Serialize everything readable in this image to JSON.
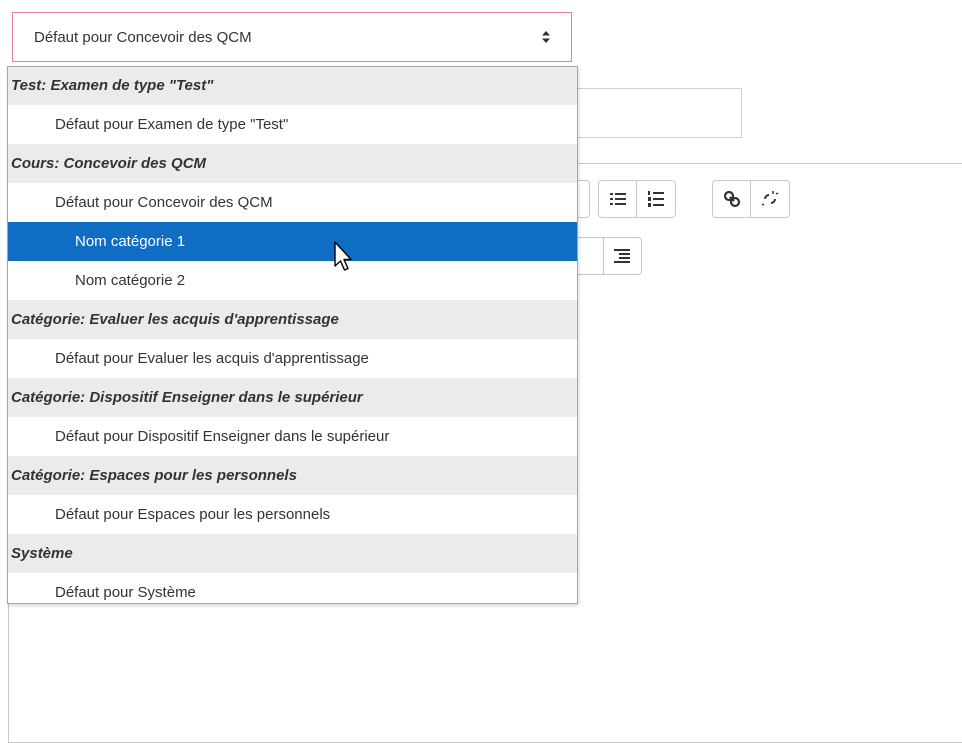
{
  "select": {
    "value": "Défaut pour Concevoir des QCM",
    "options": [
      {
        "kind": "group",
        "label": "Test: Examen de type \"Test\""
      },
      {
        "kind": "option",
        "label": "Défaut pour Examen de type \"Test\"",
        "indent": 1
      },
      {
        "kind": "group",
        "label": "Cours: Concevoir des QCM"
      },
      {
        "kind": "option",
        "label": "Défaut pour Concevoir des QCM",
        "indent": 1
      },
      {
        "kind": "option",
        "label": "Nom catégorie 1",
        "indent": 2,
        "selected": true
      },
      {
        "kind": "option",
        "label": "Nom catégorie 2",
        "indent": 2
      },
      {
        "kind": "group",
        "label": "Catégorie: Evaluer les acquis d'apprentissage"
      },
      {
        "kind": "option",
        "label": "Défaut pour Evaluer les acquis d'apprentissage",
        "indent": 1
      },
      {
        "kind": "group",
        "label": "Catégorie: Dispositif Enseigner dans le supérieur"
      },
      {
        "kind": "option",
        "label": "Défaut pour Dispositif Enseigner dans le supérieur",
        "indent": 1
      },
      {
        "kind": "group",
        "label": "Catégorie: Espaces pour les personnels"
      },
      {
        "kind": "option",
        "label": "Défaut pour Espaces pour les personnels",
        "indent": 1
      },
      {
        "kind": "group",
        "label": "Système"
      },
      {
        "kind": "option",
        "label": "Défaut pour Système",
        "indent": 1
      }
    ]
  },
  "toolbar": {
    "icons": [
      "unordered-list-icon",
      "ordered-list-icon",
      "link-icon",
      "unlink-icon",
      "outdent-icon"
    ]
  },
  "colors": {
    "selected_bg": "#0f6dc4",
    "focus_border": "#e87d9a",
    "group_bg": "#ebebeb"
  }
}
